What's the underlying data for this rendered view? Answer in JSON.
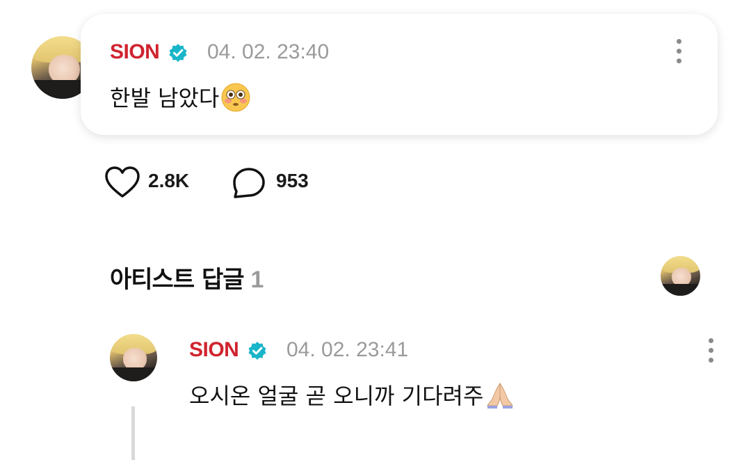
{
  "post": {
    "username": "SION",
    "timestamp": "04. 02. 23:40",
    "message": "한발 남았다",
    "emoji_icon": "flushed-face-emoji"
  },
  "stats": {
    "likes": "2.8K",
    "comments": "953"
  },
  "replies_section": {
    "title": "아티스트 답글",
    "count": "1"
  },
  "reply": {
    "username": "SION",
    "timestamp": "04. 02. 23:41",
    "message": "오시온 얼굴 곧 오니까 기다려주",
    "emoji_icon": "folded-hands-emoji"
  },
  "colors": {
    "username": "#d0232f",
    "verified": "#19b5c9",
    "timestamp": "#9a9a9a"
  }
}
